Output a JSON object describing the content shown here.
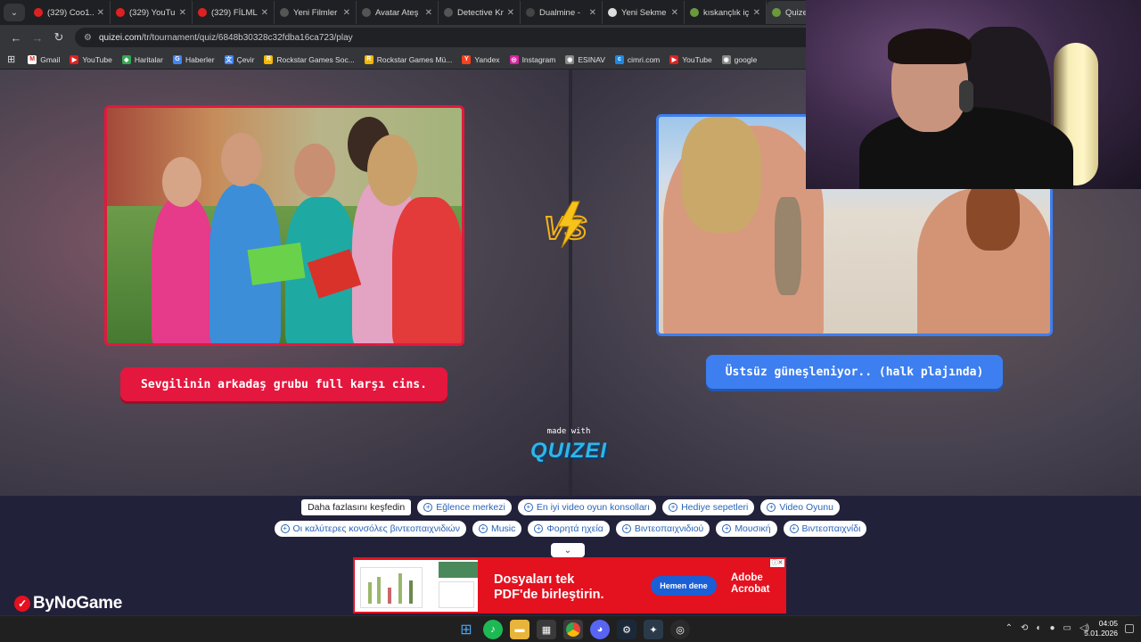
{
  "tabs": [
    {
      "title": "(329) Coo1...",
      "color": "#e02020"
    },
    {
      "title": "(329) YouTub",
      "color": "#e02020"
    },
    {
      "title": "(329) FİLMLE",
      "color": "#e02020"
    },
    {
      "title": "Yeni Filmler",
      "color": "#555555"
    },
    {
      "title": "Avatar Ateş",
      "color": "#555555"
    },
    {
      "title": "Detective Kn",
      "color": "#555555"
    },
    {
      "title": "Dualmine - ",
      "color": "#444444"
    },
    {
      "title": "Yeni Sekme",
      "color": "#dddddd"
    },
    {
      "title": "kıskançlık iç",
      "color": "#6a9a3a"
    },
    {
      "title": "Quizei",
      "color": "#6a9a3a"
    }
  ],
  "address": {
    "domain": "quizei.com",
    "path": "/tr/tournament/quiz/6848b30328c32fdba16ca723/play"
  },
  "bookmarks": [
    {
      "label": "Gmail",
      "color": "#ffffff",
      "glyph": "M",
      "icon": "gmail-icon"
    },
    {
      "label": "YouTube",
      "color": "#e02020",
      "glyph": "▶",
      "icon": "youtube-icon"
    },
    {
      "label": "Haritalar",
      "color": "#34a853",
      "glyph": "◆",
      "icon": "maps-icon"
    },
    {
      "label": "Haberler",
      "color": "#4285f4",
      "glyph": "G",
      "icon": "news-icon"
    },
    {
      "label": "Çevir",
      "color": "#4285f4",
      "glyph": "文",
      "icon": "translate-icon"
    },
    {
      "label": "Rockstar Games Soc...",
      "color": "#f5b800",
      "glyph": "R",
      "icon": "rockstar-icon"
    },
    {
      "label": "Rockstar Games Mü...",
      "color": "#f5b800",
      "glyph": "R",
      "icon": "rockstar-icon"
    },
    {
      "label": "Yandex",
      "color": "#fc3f1d",
      "glyph": "Y",
      "icon": "yandex-icon"
    },
    {
      "label": "Instagram",
      "color": "#d6249f",
      "glyph": "◎",
      "icon": "instagram-icon"
    },
    {
      "label": "ESINAV",
      "color": "#888888",
      "glyph": "◉",
      "icon": "globe-icon"
    },
    {
      "label": "cimri.com",
      "color": "#1e88e5",
      "glyph": "c",
      "icon": "cimri-icon"
    },
    {
      "label": "YouTube",
      "color": "#e02020",
      "glyph": "▶",
      "icon": "youtube-icon"
    },
    {
      "label": "google",
      "color": "#888888",
      "glyph": "◉",
      "icon": "globe-icon"
    }
  ],
  "quiz": {
    "left_label": "Sevgilinin arkadaş grubu full karşı cins.",
    "right_label": "Üstsüz güneşleniyor.. (halk plajında)",
    "vs": "VS",
    "made_with": "made with",
    "brand": "QUIZEI",
    "left_color": "#e4173e",
    "right_color": "#3d7ff0"
  },
  "discover": {
    "label": "Daha fazlasını keşfedin",
    "row1": [
      "Eğlence merkezi",
      "En iyi video oyun konsolları",
      "Hediye sepetleri",
      "Video Oyunu"
    ],
    "row2": [
      "Οι καλύτερες κονσόλες βιντεοπαιχνιδιών",
      "Music",
      "Φορητά ηχεία",
      "Βιντεοπαιχνιδιού",
      "Μουσική",
      "Βιντεοπαιχνίδι"
    ]
  },
  "ad": {
    "headline1": "Dosyaları tek",
    "headline2": "PDF'de birleştirin.",
    "button": "Hemen dene",
    "brand1": "Adobe",
    "brand2": "Acrobat"
  },
  "overlay_brand": "ByNoGame",
  "taskbar": {
    "time": "04:05",
    "date": "5.01.2026"
  }
}
